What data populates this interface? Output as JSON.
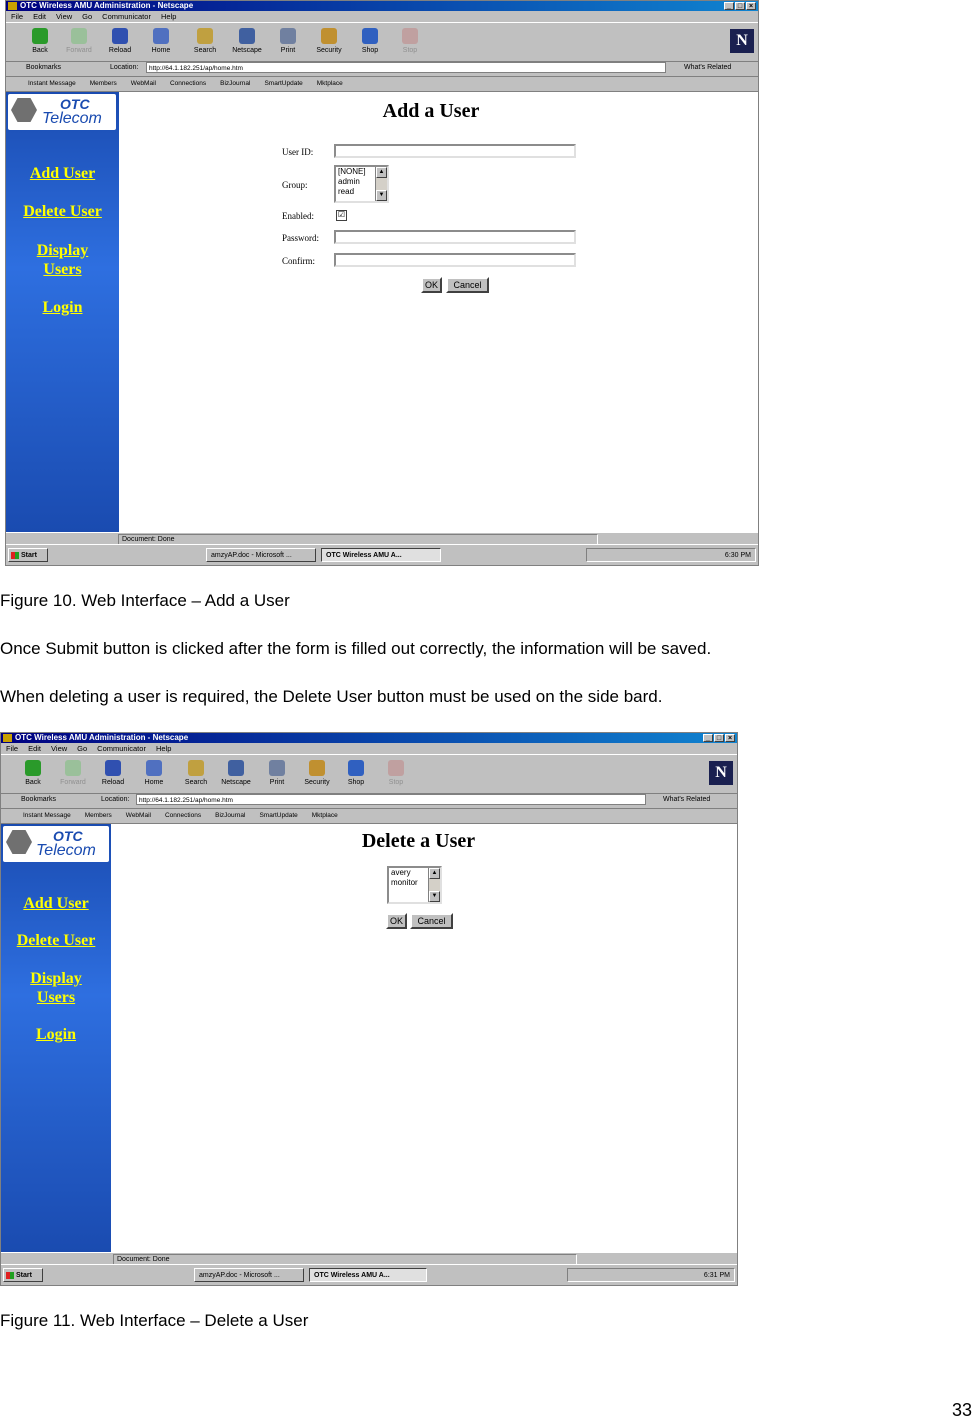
{
  "figure1": {
    "window_title": "OTC Wireless AMU Administration - Netscape",
    "window_buttons": [
      "_",
      "□",
      "×"
    ],
    "menu": [
      "File",
      "Edit",
      "View",
      "Go",
      "Communicator",
      "Help"
    ],
    "toolbar": [
      "Back",
      "Forward",
      "Reload",
      "Home",
      "Search",
      "Netscape",
      "Print",
      "Security",
      "Shop",
      "Stop"
    ],
    "netscape_logo": "N",
    "bookmarks_label": "Bookmarks",
    "location_label": "Location:",
    "url": "http://64.1.182.251/ap/home.htm",
    "whats_related": "What's Related",
    "personal_bar": [
      "Instant Message",
      "Members",
      "WebMail",
      "Connections",
      "BizJournal",
      "SmartUpdate",
      "Mktplace"
    ],
    "logo": {
      "line1": "OTC",
      "line2": "Telecom"
    },
    "nav": [
      "Add User",
      "Delete User",
      "Display",
      "Users",
      "Login"
    ],
    "page_title": "Add a User",
    "form": {
      "user_id_label": "User ID:",
      "group_label": "Group:",
      "group_options": [
        "[NONE]",
        "admin",
        "read"
      ],
      "enabled_label": "Enabled:",
      "enabled_mark": "☑",
      "password_label": "Password:",
      "confirm_label": "Confirm:",
      "ok": "OK",
      "cancel": "Cancel"
    },
    "status_text": "Document: Done",
    "taskbar": {
      "start": "Start",
      "task1": "amzyAP.doc - Microsoft ...",
      "task2": "OTC Wireless AMU A...",
      "time": "6:30 PM"
    }
  },
  "caption1": "Figure 10.  Web Interface – Add a User",
  "paragraph1": "Once Submit button is clicked after the form is filled out correctly, the information will be saved.",
  "paragraph2": "When deleting a user is required, the Delete User button must be used on the side bard.",
  "figure2": {
    "window_title": "OTC Wireless AMU Administration - Netscape",
    "window_buttons": [
      "_",
      "□",
      "×"
    ],
    "menu": [
      "File",
      "Edit",
      "View",
      "Go",
      "Communicator",
      "Help"
    ],
    "toolbar": [
      "Back",
      "Forward",
      "Reload",
      "Home",
      "Search",
      "Netscape",
      "Print",
      "Security",
      "Shop",
      "Stop"
    ],
    "netscape_logo": "N",
    "bookmarks_label": "Bookmarks",
    "location_label": "Location:",
    "url": "http://64.1.182.251/ap/home.htm",
    "whats_related": "What's Related",
    "personal_bar": [
      "Instant Message",
      "Members",
      "WebMail",
      "Connections",
      "BizJournal",
      "SmartUpdate",
      "Mktplace"
    ],
    "logo": {
      "line1": "OTC",
      "line2": "Telecom"
    },
    "nav": [
      "Add User",
      "Delete User",
      "Display",
      "Users",
      "Login"
    ],
    "page_title": "Delete a User",
    "user_list": [
      "avery",
      "monitor"
    ],
    "ok": "OK",
    "cancel": "Cancel",
    "status_text": "Document: Done",
    "taskbar": {
      "start": "Start",
      "task1": "amzyAP.doc - Microsoft ...",
      "task2": "OTC Wireless AMU A...",
      "time": "6:31 PM"
    }
  },
  "caption2": "Figure 11.  Web Interface – Delete a User",
  "page_number": "33",
  "colors": {
    "sidebar_blue": "#1a4bb0",
    "nav_link_yellow": "#ffff00",
    "titlebar": "#000080"
  }
}
